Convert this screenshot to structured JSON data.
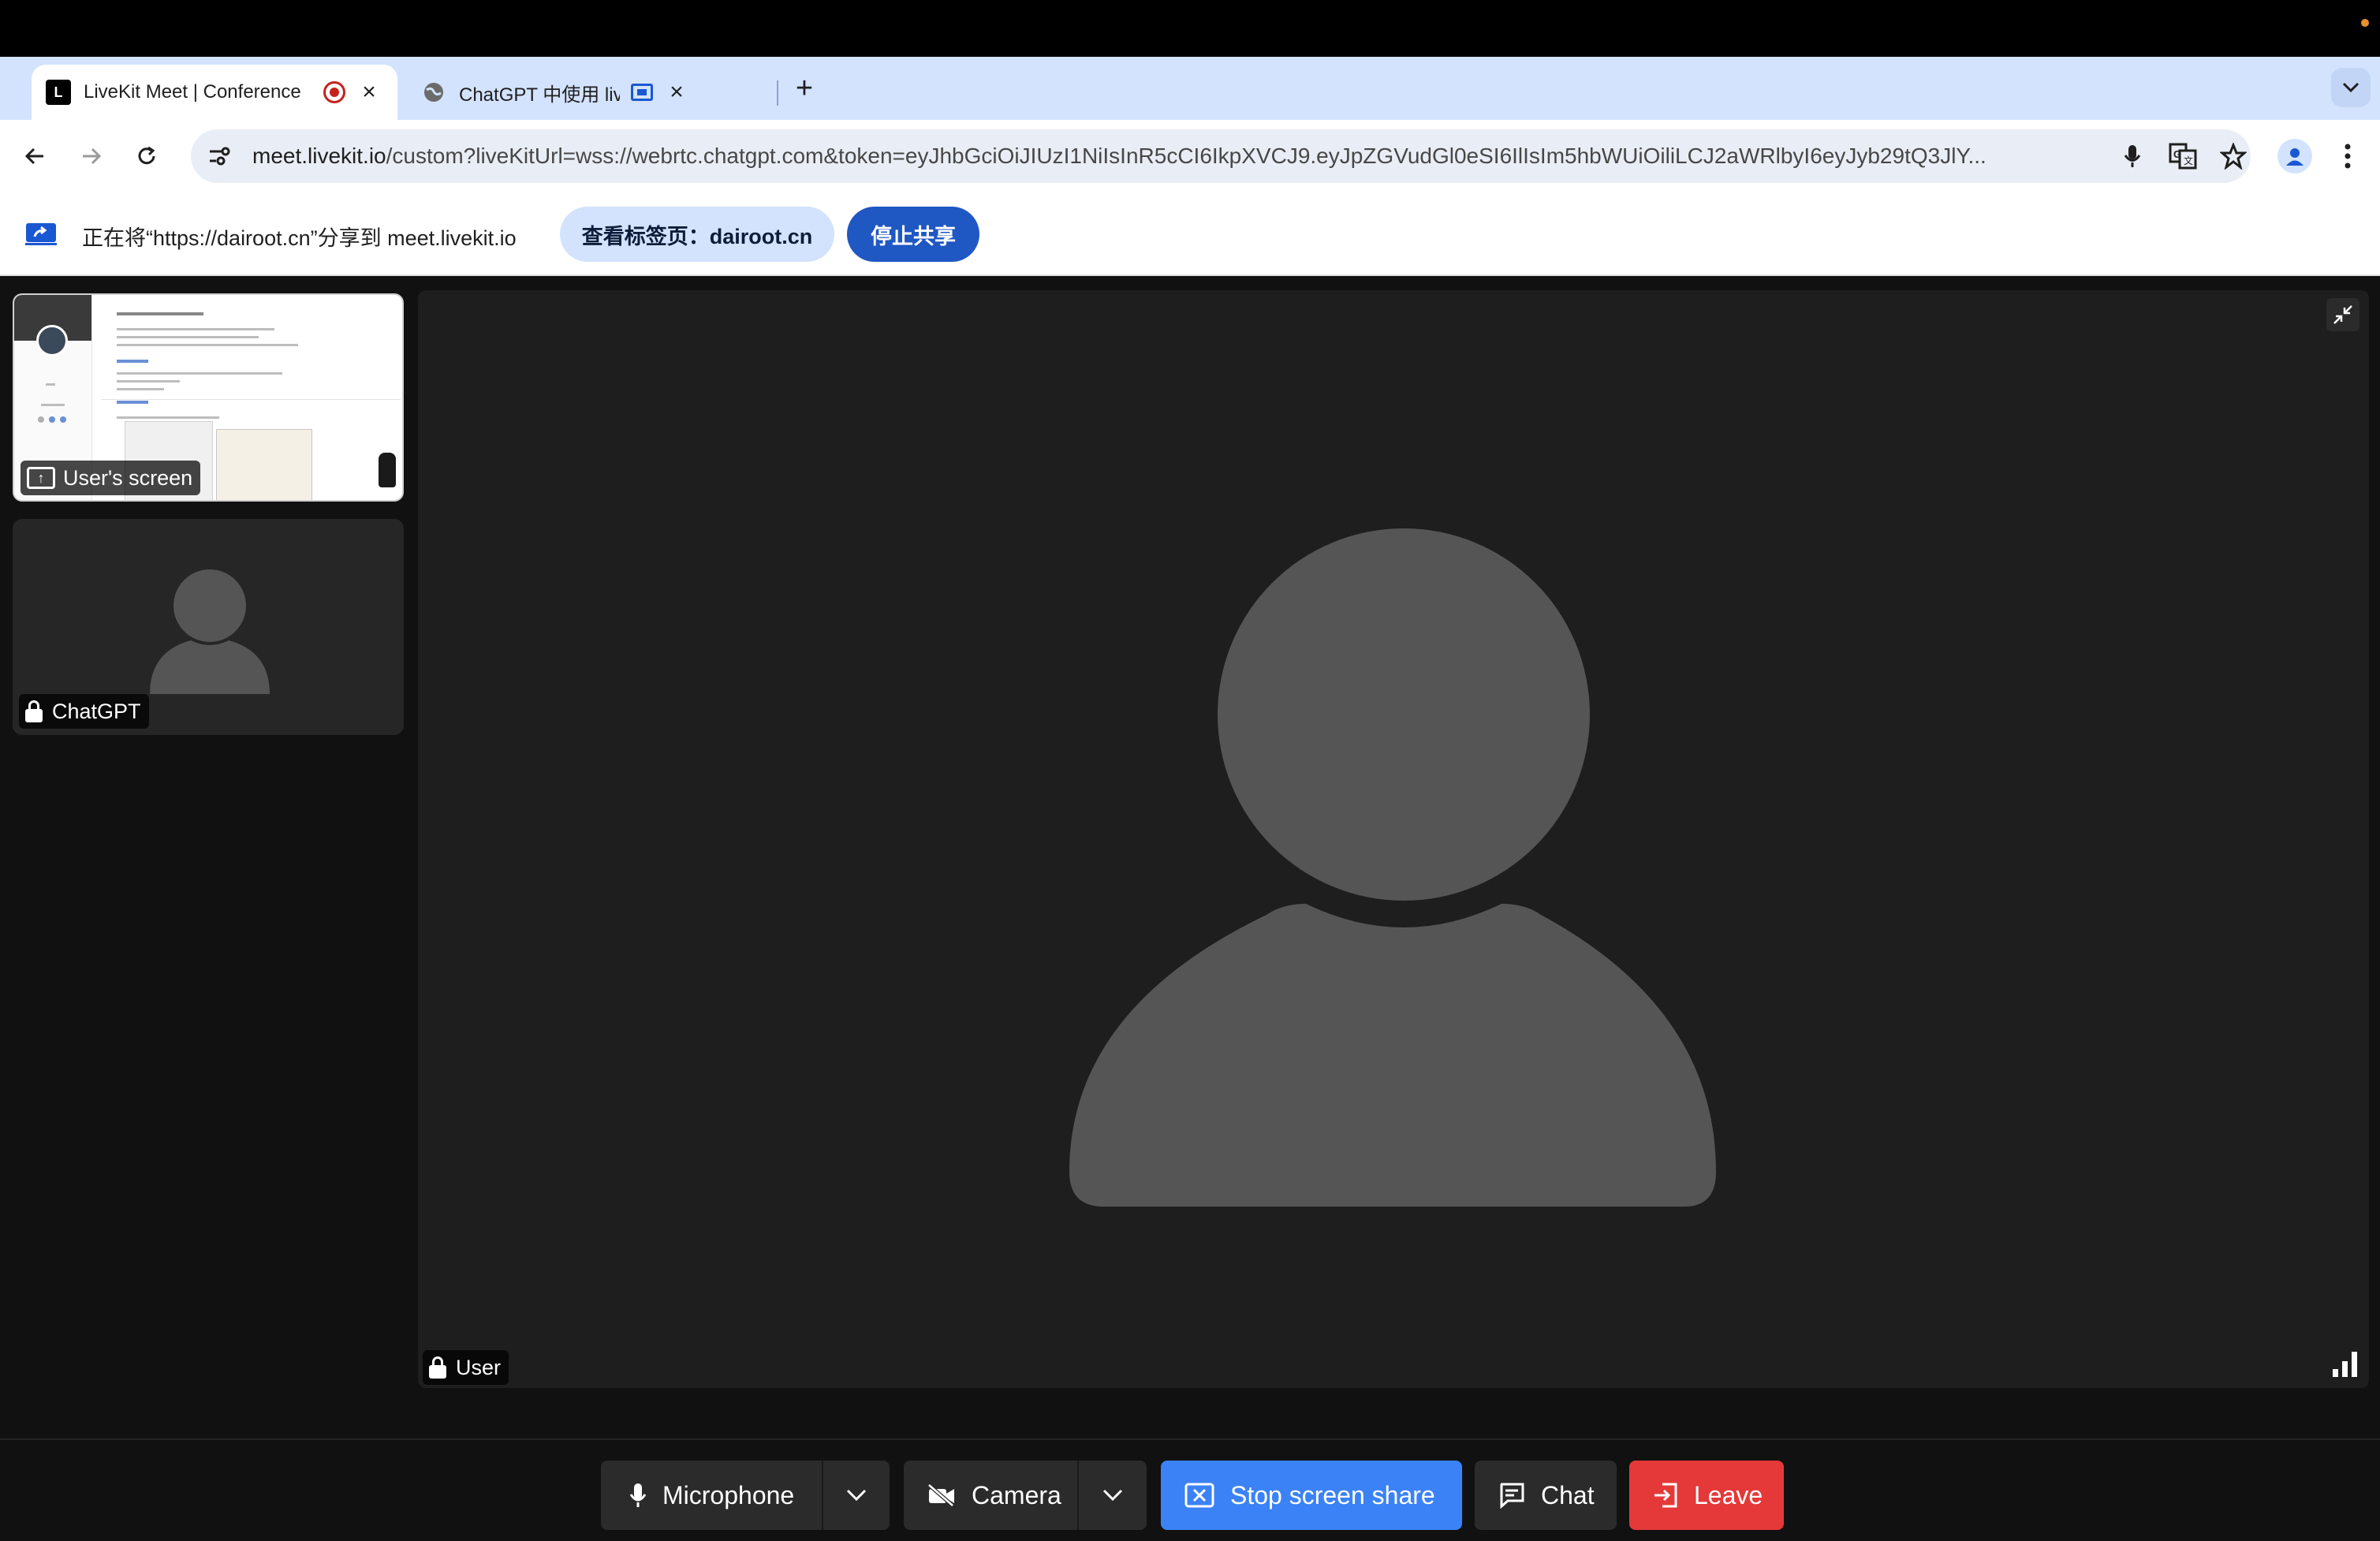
{
  "browser": {
    "tabs": [
      {
        "title": "LiveKit Meet | Conference",
        "favicon": "livekit-logo",
        "indicator": "recording-icon",
        "active": true
      },
      {
        "title": "ChatGPT 中使用 livekit 实",
        "favicon": "globe-icon",
        "indicator": "tab-sharing-icon",
        "active": false
      }
    ],
    "url_host": "meet.livekit.io",
    "url_rest": "/custom?liveKitUrl=wss://webrtc.chatgpt.com&token=eyJhbGciOiJIUzI1NiIsInR5cCI6IkpXVCJ9.eyJpZGVudGl0eSI6IlIsIm5hbWUiOiliLCJ2aWRlbyI6eyJyb29tQ3JlY..."
  },
  "infobar": {
    "message": "正在将“https://dairoot.cn”分享到 meet.livekit.io",
    "view_tab_button": "查看标签页：dairoot.cn",
    "stop_share_button": "停止共享"
  },
  "participants": {
    "screen_share_label": "User's screen",
    "chatgpt_label": "ChatGPT",
    "main_label": "User"
  },
  "controls": {
    "microphone": "Microphone",
    "camera": "Camera",
    "stop_screen_share": "Stop screen share",
    "chat": "Chat",
    "leave": "Leave"
  },
  "colors": {
    "share_button": "#3b82f6",
    "leave_button": "#e53939",
    "stop_share_chrome": "#1f57c3",
    "avatar_placeholder": "#555555"
  }
}
